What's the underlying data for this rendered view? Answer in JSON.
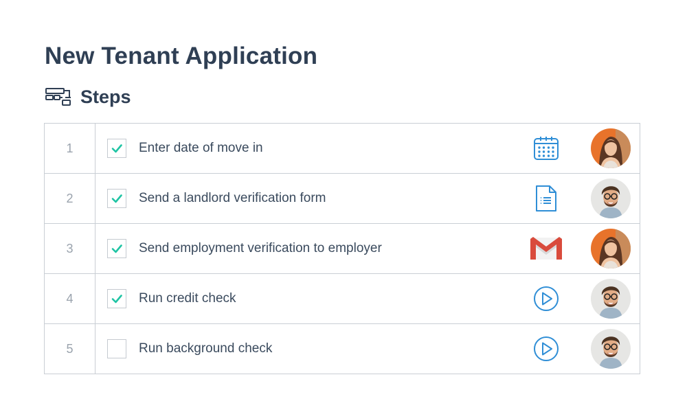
{
  "title": "New Tenant Application",
  "section": {
    "title": "Steps",
    "icon": "workflow-icon"
  },
  "colors": {
    "check": "#1fc4a4",
    "accent_blue": "#2f8ed6",
    "text": "#2f3f54"
  },
  "steps": [
    {
      "number": "1",
      "label": "Enter date of move in",
      "checked": true,
      "tool_icon": "calendar-icon",
      "assignee": "woman-avatar"
    },
    {
      "number": "2",
      "label": "Send a landlord verification form",
      "checked": true,
      "tool_icon": "document-icon",
      "assignee": "man-avatar"
    },
    {
      "number": "3",
      "label": "Send employment verification to employer",
      "checked": true,
      "tool_icon": "gmail-icon",
      "assignee": "woman-avatar"
    },
    {
      "number": "4",
      "label": "Run credit check",
      "checked": true,
      "tool_icon": "play-icon",
      "assignee": "man-avatar"
    },
    {
      "number": "5",
      "label": "Run background check",
      "checked": false,
      "tool_icon": "play-icon",
      "assignee": "man-avatar"
    }
  ]
}
